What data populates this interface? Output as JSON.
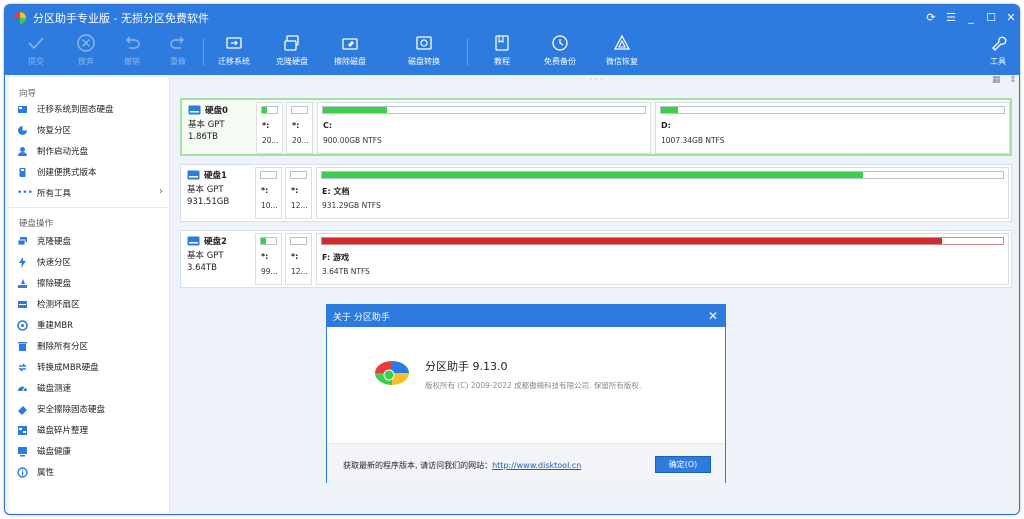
{
  "window": {
    "title": "分区助手专业版 - 无损分区免费软件"
  },
  "toolbar": {
    "commit": "提交",
    "discard": "放弃",
    "undo": "撤销",
    "redo": "重做",
    "migrate_os": "迁移系统",
    "clone_disk": "克隆硬盘",
    "wipe_disk": "擦除磁盘",
    "convert_disk": "磁盘转换",
    "tutorial": "教程",
    "free_backup": "免费备份",
    "wechat": "微信恢复",
    "tools": "工具"
  },
  "sidebar": {
    "wizard_title": "向导",
    "wizard_items": [
      "迁移系统到固态硬盘",
      "恢复分区",
      "制作启动光盘",
      "创建便携式版本",
      "所有工具"
    ],
    "disk_ops_title": "硬盘操作",
    "disk_items": [
      "克隆硬盘",
      "快速分区",
      "擦除硬盘",
      "检测坏扇区",
      "重建MBR",
      "删除所有分区",
      "转换成MBR硬盘",
      "磁盘测速",
      "安全擦除固态硬盘",
      "磁盘碎片整理",
      "磁盘健康",
      "属性"
    ]
  },
  "disks": [
    {
      "name": "硬盘0",
      "type": "基本 GPT",
      "size": "1.86TB",
      "partitions": [
        {
          "letter": "*:",
          "info": "20...",
          "used": 0.3,
          "color": "#3ccf4e"
        },
        {
          "letter": "*:",
          "info": "20...",
          "used": 0.0,
          "color": "#3ccf4e"
        },
        {
          "letter": "C:",
          "info": "900.00GB NTFS",
          "used": 0.2,
          "color": "#3ccf4e"
        },
        {
          "letter": "D:",
          "info": "1007.34GB NTFS",
          "used": 0.05,
          "color": "#3ccf4e"
        }
      ]
    },
    {
      "name": "硬盘1",
      "type": "基本 GPT",
      "size": "931.51GB",
      "partitions": [
        {
          "letter": "*:",
          "info": "10...",
          "used": 0.0,
          "color": "#3ccf4e"
        },
        {
          "letter": "*:",
          "info": "12...",
          "used": 0.0,
          "color": "#3ccf4e"
        },
        {
          "letter": "E: 文档",
          "info": "931.29GB NTFS",
          "used": 0.8,
          "color": "#3ccf4e"
        }
      ]
    },
    {
      "name": "硬盘2",
      "type": "基本 GPT",
      "size": "3.64TB",
      "partitions": [
        {
          "letter": "*:",
          "info": "99...",
          "used": 0.3,
          "color": "#3ccf4e"
        },
        {
          "letter": "*:",
          "info": "12...",
          "used": 0.0,
          "color": "#3ccf4e"
        },
        {
          "letter": "F: 游戏",
          "info": "3.64TB NTFS",
          "used": 0.91,
          "color": "#d02a2a"
        }
      ]
    }
  ],
  "dialog": {
    "title": "关于 分区助手",
    "product": "分区助手 9.13.0",
    "copyright": "版权所有 (C) 2009-2022 成都傲梅科技有限公司. 保留所有版权.",
    "prompt": "获取最新的程序版本, 请访问我们的网站：",
    "link": "http://www.disktool.cn",
    "ok": "确定(O)"
  },
  "colors": {
    "accent": "#2d7bdf",
    "used_green": "#3ccf4e",
    "used_red": "#d02a2a"
  }
}
